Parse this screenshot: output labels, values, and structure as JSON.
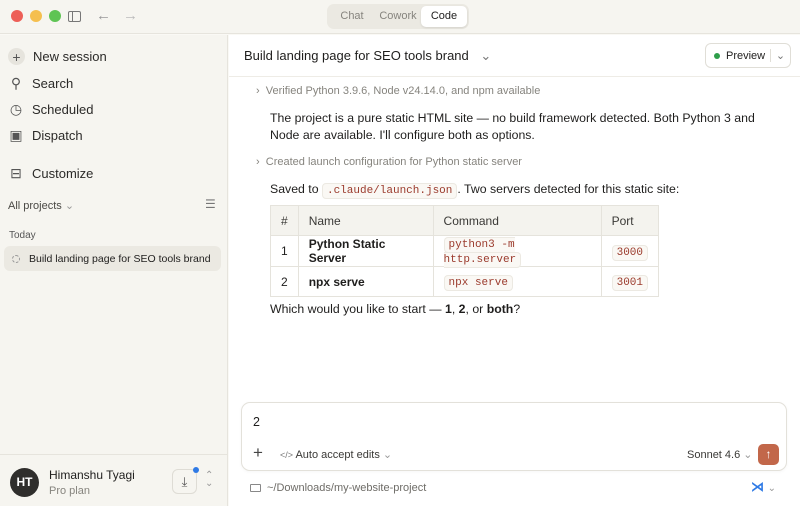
{
  "window": {
    "tabs": [
      "Chat",
      "Cowork",
      "Code"
    ],
    "active_tab": "Code"
  },
  "sidebar": {
    "items": [
      {
        "icon": "plus-icon",
        "label": "New session"
      },
      {
        "icon": "search-icon",
        "label": "Search"
      },
      {
        "icon": "clock-icon",
        "label": "Scheduled"
      },
      {
        "icon": "dispatch-icon",
        "label": "Dispatch"
      }
    ],
    "customize": "Customize",
    "projects_filter": "All projects",
    "section": "Today",
    "sessions": [
      "Build landing page for SEO tools brand"
    ],
    "user": {
      "initials": "HT",
      "name": "Himanshu Tyagi",
      "plan": "Pro plan"
    }
  },
  "header": {
    "title": "Build landing page for SEO tools brand",
    "preview": "Preview",
    "preview_status_color": "#2e9e4a"
  },
  "conversation": {
    "step1": "Verified Python 3.9.6, Node v24.14.0, and npm available",
    "para1": "The project is a pure static HTML site — no build framework detected. Both Python 3 and Node are available. I'll configure both as options.",
    "step2": "Created launch configuration for Python static server",
    "saved_pre": "Saved to ",
    "saved_code": ".claude/launch.json",
    "saved_post": ". Two servers detected for this static site:",
    "table": {
      "headers": [
        "#",
        "Name",
        "Command",
        "Port"
      ],
      "rows": [
        [
          "1",
          "Python Static Server",
          "python3 -m http.server",
          "3000"
        ],
        [
          "2",
          "npx serve",
          "npx serve",
          "3001"
        ]
      ]
    },
    "q_pre": "Which would you like to start — ",
    "q_1": "1",
    "q_sep1": ", ",
    "q_2": "2",
    "q_sep2": ", or ",
    "q_both": "both",
    "q_end": "?"
  },
  "composer": {
    "value": "2",
    "mode": "Auto accept edits",
    "model": "Sonnet 4.6",
    "accent": "#c2674a"
  },
  "footer": {
    "path": "~/Downloads/my-website-project"
  }
}
